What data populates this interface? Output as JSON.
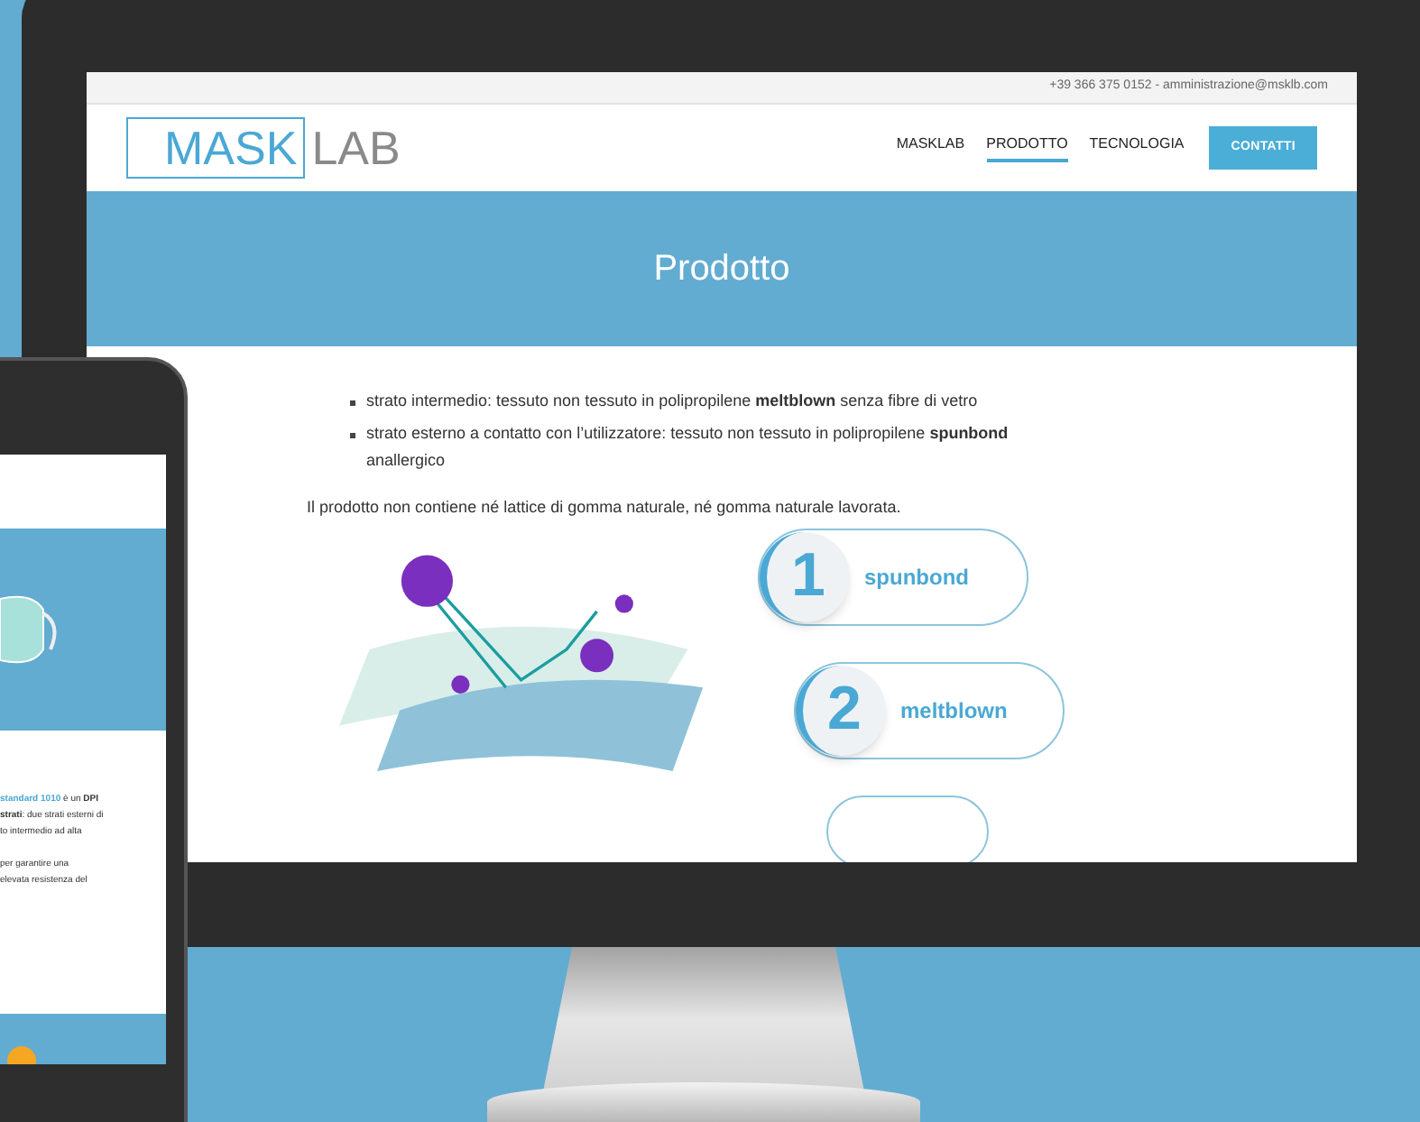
{
  "website": {
    "contact_line": "+39 366 375 0152 - amministrazione@msklb.com",
    "logo": {
      "part_1": "MASK",
      "part_2": "LAB"
    },
    "nav": [
      {
        "label": "MASKLAB",
        "kind": "link",
        "selected": false
      },
      {
        "label": "PRODOTTO",
        "kind": "link",
        "selected": true
      },
      {
        "label": "TECNOLOGIA",
        "kind": "link",
        "selected": false
      },
      {
        "label": "CONTATTI",
        "kind": "button",
        "selected": false
      }
    ],
    "hero_title": "Prodotto",
    "bullets": [
      "strato intermedio: tessuto non tessuto in polipropilene **meltblown** senza fibre di vetro",
      "strato esterno a contatto con l’utilizzatore: tessuto non tessuto in polipropilene **spunbond** anallergico"
    ],
    "paragraph": "Il prodotto non contiene né lattice di gomma naturale, né gomma naturale lavorata.",
    "layers": [
      {
        "number": "1",
        "label": "spunbond"
      },
      {
        "number": "2",
        "label": "meltblown"
      }
    ]
  },
  "phone": {
    "text_lines": [
      "**standard 1010** è un **DPI**",
      "**strati**: due strati esterni di",
      "to intermedio ad alta",
      "per garantire una",
      "elevata resistenza del"
    ]
  }
}
